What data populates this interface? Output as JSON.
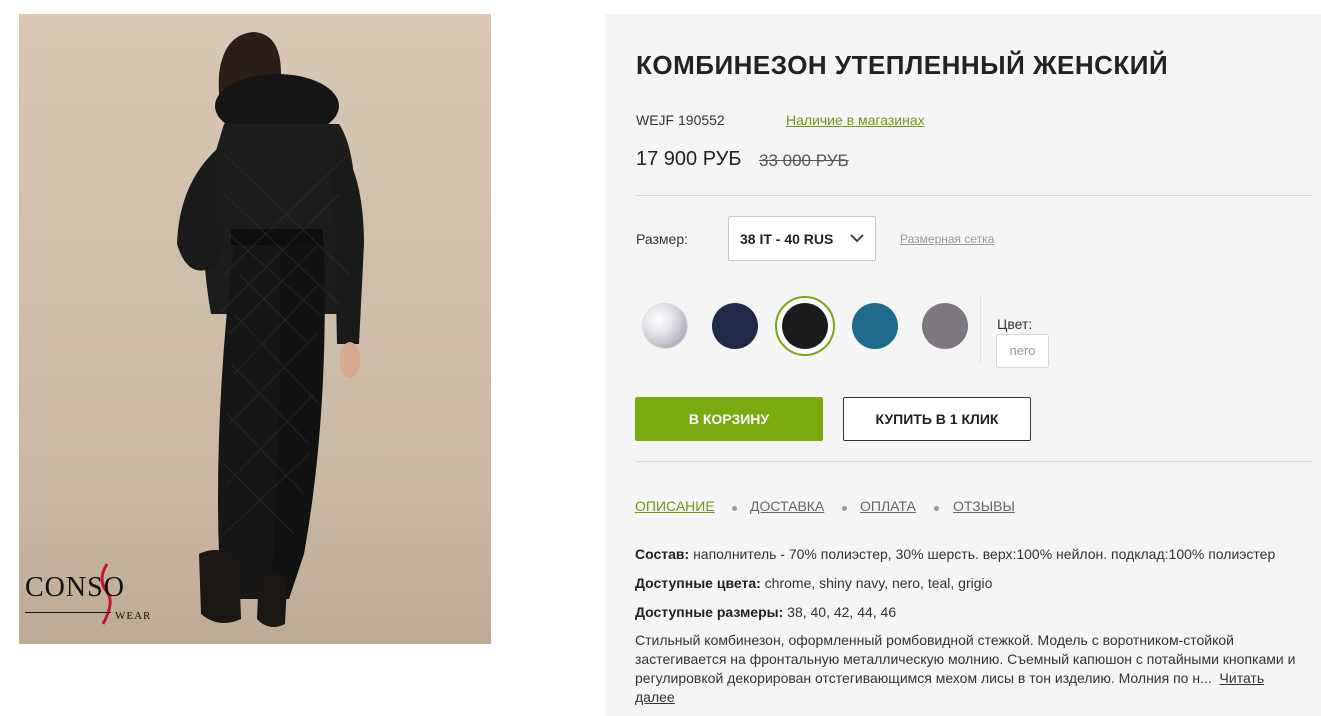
{
  "photo": {
    "alt_brand": "CONSO",
    "alt_wear": "WEAR"
  },
  "product": {
    "title": "КОМБИНЕЗОН УТЕПЛЕННЫЙ ЖЕНСКИЙ",
    "sku": "WEJF 190552",
    "stock_link": "Наличие в магазинах",
    "price": "17 900 РУБ",
    "old_price": "33 000 РУБ"
  },
  "size": {
    "label": "Размер:",
    "selected": "38 IT - 40 RUS",
    "grid_link": "Размерная сетка"
  },
  "colors": {
    "label": "Цвет:",
    "selected": "nero",
    "swatches": [
      {
        "name": "chrome",
        "hex": "#d0d0d8"
      },
      {
        "name": "shiny navy",
        "hex": "#1f2a48"
      },
      {
        "name": "nero",
        "hex": "#1b1b1b"
      },
      {
        "name": "teal",
        "hex": "#1e6a8a"
      },
      {
        "name": "grigio",
        "hex": "#7d7880"
      }
    ]
  },
  "buttons": {
    "cart": "В КОРЗИНУ",
    "one_click": "КУПИТЬ В 1 КЛИК"
  },
  "tabs": [
    {
      "label": "ОПИСАНИЕ",
      "active": true
    },
    {
      "label": "ДОСТАВКА",
      "active": false
    },
    {
      "label": "ОПЛАТА",
      "active": false
    },
    {
      "label": "ОТЗЫВЫ",
      "active": false
    }
  ],
  "specs": {
    "composition_label": "Состав:",
    "composition_value": " наполнитель - 70% полиэстер, 30% шерсть. верх:100% нейлон. подклад:100% полиэстер",
    "colors_label": "Доступные цвета:",
    "colors_value": " chrome, shiny navy, nero, teal, grigio",
    "sizes_label": "Доступные размеры:",
    "sizes_value": " 38, 40, 42, 44, 46"
  },
  "description": {
    "text": "Стильный комбинезон, оформленный ромбовидной стежкой. Модель с воротником-стойкой застегивается на фронтальную металлическую молнию. Съемный капюшон с потайными кнопками и регулировкой декорирован отстегивающимся мехом лисы в тон изделию. Молния по н...",
    "read_more": "Читать далее"
  },
  "theme": {
    "accent": "#7aaa10",
    "link_green": "#6a9a12",
    "panel_bg": "#f5f5f5"
  }
}
